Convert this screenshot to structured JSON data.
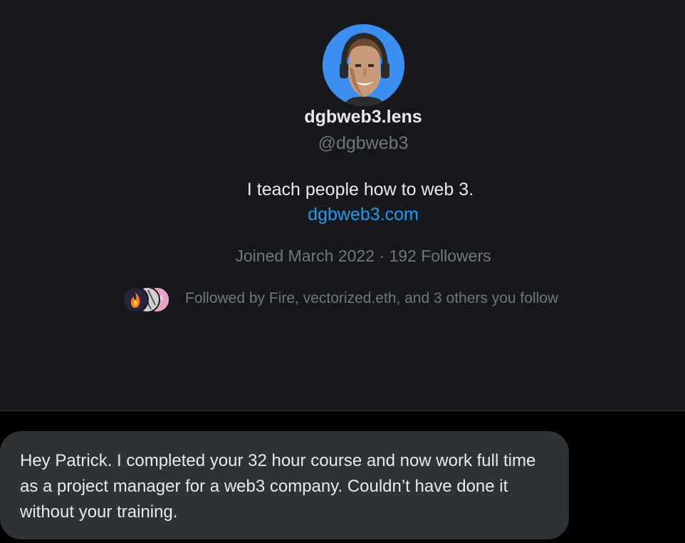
{
  "profile": {
    "display_name": "dgbweb3.lens",
    "handle": "@dgbweb3",
    "bio": "I teach people how to web 3.",
    "website": "dgbweb3.com",
    "joined_and_followers": "Joined March 2022 · 192 Followers",
    "followed_by": "Followed by Fire, vectorized.eth, and 3 others you follow",
    "avatar_icon": "profile-avatar",
    "follower_avatar_icons": [
      "fire-avatar",
      "vectorized-avatar",
      "pink-avatar"
    ]
  },
  "message": {
    "text": "Hey Patrick. I completed your 32 hour course and now work full time as a project manager for a web3 company. Couldn’t have done it without your training."
  },
  "colors": {
    "card_background": "#16181c",
    "page_background": "#000000",
    "accent_link": "#1d9bf0",
    "avatar_ring": "#3b8ff0",
    "bubble_background": "#2f3336",
    "secondary_text": "#71767b",
    "primary_text": "#e7e9ea"
  }
}
